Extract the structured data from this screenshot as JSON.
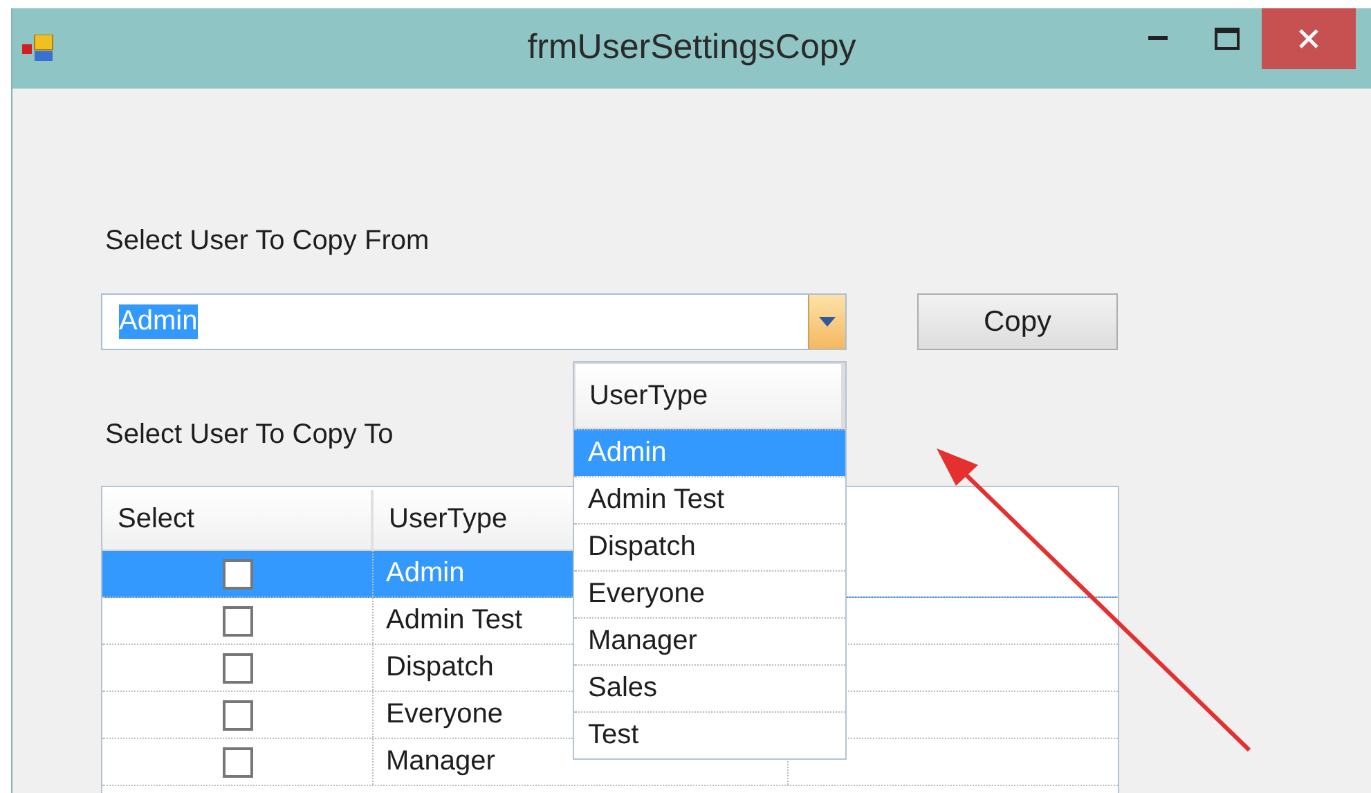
{
  "window": {
    "title": "frmUserSettingsCopy"
  },
  "from_label": "Select User To Copy From",
  "combo": {
    "value": "Admin",
    "text_selected": true,
    "open": true
  },
  "copy_button": "Copy",
  "dropdown": {
    "header": "UserType",
    "items": [
      {
        "label": "Admin",
        "selected": true
      },
      {
        "label": "Admin Test",
        "selected": false
      },
      {
        "label": "Dispatch",
        "selected": false
      },
      {
        "label": "Everyone",
        "selected": false
      },
      {
        "label": "Manager",
        "selected": false
      },
      {
        "label": "Sales",
        "selected": false
      },
      {
        "label": "Test",
        "selected": false
      }
    ]
  },
  "to_label": "Select User To Copy To",
  "grid": {
    "columns": [
      "Select",
      "UserType"
    ],
    "rows": [
      {
        "checked": false,
        "user_type": "Admin",
        "selected": true
      },
      {
        "checked": false,
        "user_type": "Admin Test",
        "selected": false
      },
      {
        "checked": false,
        "user_type": "Dispatch",
        "selected": false
      },
      {
        "checked": false,
        "user_type": "Everyone",
        "selected": false
      },
      {
        "checked": false,
        "user_type": "Manager",
        "selected": false
      }
    ]
  }
}
